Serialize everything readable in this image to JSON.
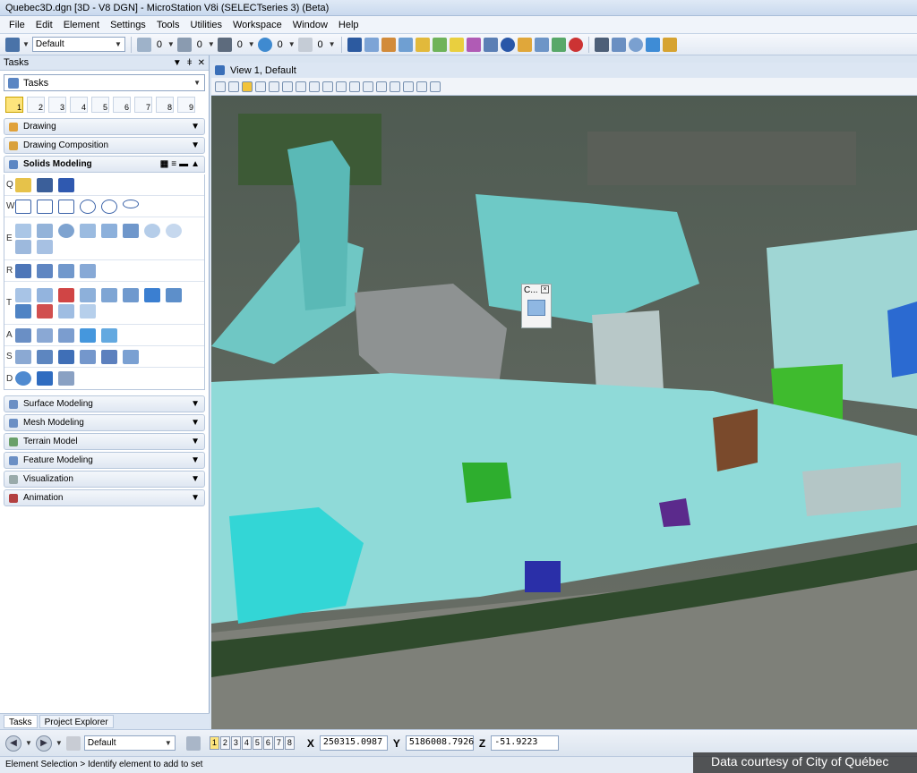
{
  "window": {
    "title": "Quebec3D.dgn [3D - V8 DGN] - MicroStation V8i (SELECTseries 3) (Beta)"
  },
  "menu": [
    "File",
    "Edit",
    "Element",
    "Settings",
    "Tools",
    "Utilities",
    "Workspace",
    "Window",
    "Help"
  ],
  "toolbar": {
    "level_select": "Default",
    "counters": [
      "0",
      "0",
      "0",
      "0",
      "0"
    ],
    "accent": "#3a6fb8"
  },
  "tasks_panel": {
    "header": "Tasks",
    "task_select": "Tasks",
    "select_tools": [
      "1",
      "2",
      "3",
      "4",
      "5",
      "6",
      "7",
      "8",
      "9"
    ],
    "groups_top": [
      "Drawing",
      "Drawing Composition"
    ],
    "open_group": "Solids Modeling",
    "solids_rows": [
      {
        "key": "Q",
        "count": 3
      },
      {
        "key": "W",
        "count": 6
      },
      {
        "key": "E",
        "count": 8
      },
      {
        "key": "R",
        "count": 4
      },
      {
        "key": "T",
        "count": 12
      },
      {
        "key": "A",
        "count": 5
      },
      {
        "key": "S",
        "count": 6
      },
      {
        "key": "D",
        "count": 3
      }
    ],
    "groups_bottom": [
      "Surface Modeling",
      "Mesh Modeling",
      "Terrain Model",
      "Feature Modeling",
      "Visualization",
      "Animation"
    ],
    "tabs": [
      "Tasks",
      "Project Explorer"
    ]
  },
  "view": {
    "title": "View 1, Default",
    "mini_toolbox_title": "C..."
  },
  "status": {
    "level": "Default",
    "view_numbers": [
      "1",
      "2",
      "3",
      "4",
      "5",
      "6",
      "7",
      "8"
    ],
    "x_label": "X",
    "x_value": "250315.0987",
    "y_label": "Y",
    "y_value": "5186008.7926",
    "z_label": "Z",
    "z_value": "-51.9223",
    "prompt": "Element Selection > Identify element to add to set"
  },
  "credit": "Data courtesy of City of Québec"
}
